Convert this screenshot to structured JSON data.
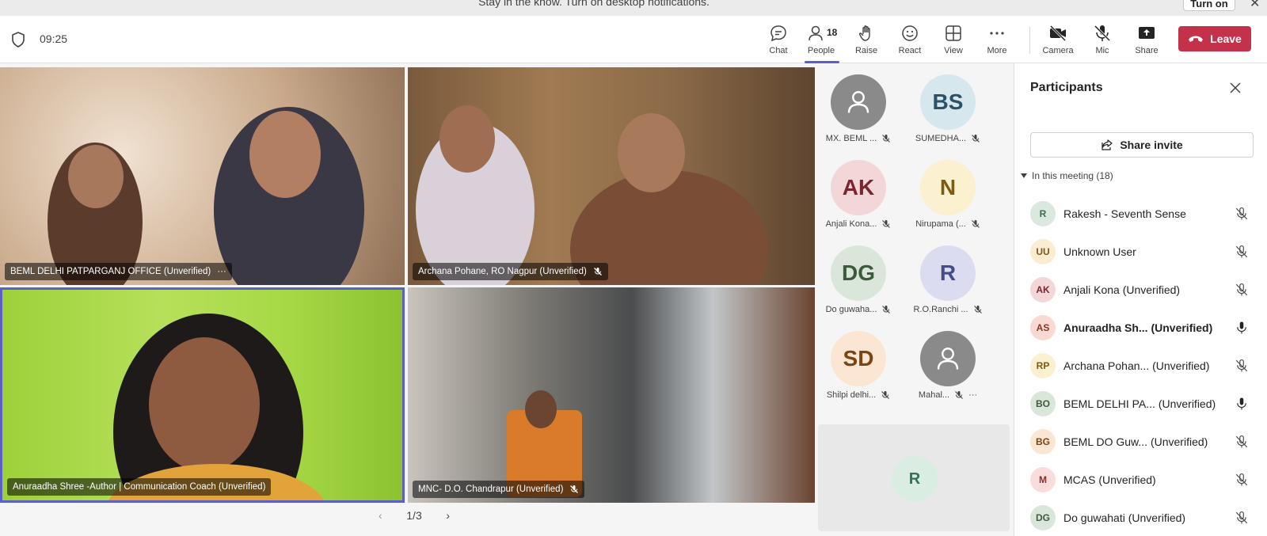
{
  "banner": {
    "text": "Stay in the know. Turn on desktop notifications.",
    "button": "Turn on"
  },
  "topbar": {
    "timer": "09:25",
    "chat": "Chat",
    "people": "People",
    "people_count": "18",
    "raise": "Raise",
    "react": "React",
    "view": "View",
    "more": "More",
    "camera": "Camera",
    "mic": "Mic",
    "share": "Share",
    "leave": "Leave"
  },
  "videos": [
    {
      "name": "BEML DELHI PATPARGANJ OFFICE (Unverified)"
    },
    {
      "name": "Archana Pohane, RO Nagpur (Unverified)"
    },
    {
      "name": "Anuraadha Shree -Author | Communication Coach (Unverified)"
    },
    {
      "name": "MNC- D.O. Chandrapur (Unverified)"
    }
  ],
  "pager": {
    "page": "1/3"
  },
  "tiles": [
    {
      "initials": "",
      "name": "MX. BEML ...",
      "bg": "#8a8a8a",
      "fg": "#ffffff"
    },
    {
      "initials": "BS",
      "name": "SUMEDHA...",
      "bg": "#d6e7ee",
      "fg": "#2b5266"
    },
    {
      "initials": "AK",
      "name": "Anjali Kona...",
      "bg": "#f3d6d8",
      "fg": "#7a2530"
    },
    {
      "initials": "N",
      "name": "Nirupama (...",
      "bg": "#fbf0cf",
      "fg": "#7a5d10"
    },
    {
      "initials": "DG",
      "name": "Do guwaha...",
      "bg": "#dbe6da",
      "fg": "#3d5a3a"
    },
    {
      "initials": "R",
      "name": "R.O.Ranchi ...",
      "bg": "#dcdcf1",
      "fg": "#454a8c"
    },
    {
      "initials": "SD",
      "name": "Shilpi delhi...",
      "bg": "#fbe6d3",
      "fg": "#7a4413"
    },
    {
      "initials": "",
      "name": "Mahal...",
      "bg": "#8a8a8a",
      "fg": "#ffffff"
    }
  ],
  "r_tile": {
    "initials": "R"
  },
  "panel": {
    "title": "Participants",
    "share_invite": "Share invite",
    "section": "In this meeting (18)",
    "participants": [
      {
        "initials": "R",
        "name": "Rakesh - Seventh Sense",
        "bold": false,
        "muted": true,
        "bg": "#dbe8de",
        "fg": "#3e6b4c"
      },
      {
        "initials": "UU",
        "name": "Unknown User",
        "bold": false,
        "muted": true,
        "bg": "#fbecd2",
        "fg": "#7a5a18"
      },
      {
        "initials": "AK",
        "name": "Anjali Kona (Unverified)",
        "bold": false,
        "muted": true,
        "bg": "#f3d6d8",
        "fg": "#7a2530"
      },
      {
        "initials": "AS",
        "name": "Anuraadha Sh...  (Unverified)",
        "bold": true,
        "muted": false,
        "bg": "#f9d9d3",
        "fg": "#8a3424"
      },
      {
        "initials": "RP",
        "name": "Archana Pohan... (Unverified)",
        "bold": false,
        "muted": true,
        "bg": "#fbf0cf",
        "fg": "#7a5d10"
      },
      {
        "initials": "BO",
        "name": "BEML DELHI PA... (Unverified)",
        "bold": false,
        "muted": false,
        "bg": "#dbe6da",
        "fg": "#3d5a3a"
      },
      {
        "initials": "BG",
        "name": "BEML DO Guw...  (Unverified)",
        "bold": false,
        "muted": true,
        "bg": "#fbe6d3",
        "fg": "#7a4413"
      },
      {
        "initials": "M",
        "name": "MCAS (Unverified)",
        "bold": false,
        "muted": true,
        "bg": "#f9dcdc",
        "fg": "#8a2e2e"
      },
      {
        "initials": "DG",
        "name": "Do guwahati (Unverified)",
        "bold": false,
        "muted": true,
        "bg": "#dbe6da",
        "fg": "#3d5a3a"
      }
    ]
  }
}
